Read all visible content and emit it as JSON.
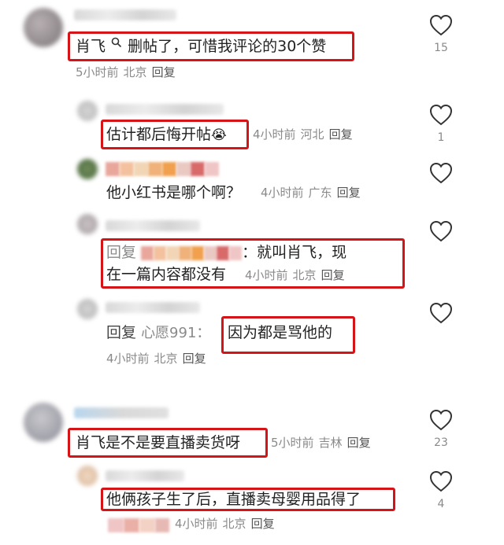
{
  "comments": [
    {
      "text_parts": [
        "肖飞",
        "删帖了，可惜我评论的30个赞"
      ],
      "time": "5小时前",
      "location": "北京",
      "reply_label": "回复",
      "likes": "15"
    },
    {
      "text": "估计都后悔开帖",
      "emoji": "😭",
      "time": "4小时前",
      "location": "河北",
      "reply_label": "回复",
      "likes": "1"
    },
    {
      "text": "他小红书是哪个啊？",
      "time": "4小时前",
      "location": "广东",
      "reply_label": "回复",
      "likes": ""
    },
    {
      "prefix": "回复",
      "line1": "：就叫肖飞，现",
      "line2": "在一篇内容都没有",
      "time": "4小时前",
      "location": "北京",
      "reply_label": "回复",
      "likes": ""
    },
    {
      "prefix": "回复",
      "mention": "心愿991：",
      "text": "因为都是骂他的",
      "time": "4小时前",
      "location": "北京",
      "reply_label": "回复",
      "likes": ""
    },
    {
      "text": "肖飞是不是要直播卖货呀",
      "time": "5小时前",
      "location": "吉林",
      "reply_label": "回复",
      "likes": "23"
    },
    {
      "text": "他俩孩子生了后，直播卖母婴用品得了",
      "time": "4小时前",
      "location": "北京",
      "reply_label": "回复",
      "likes": "4"
    }
  ],
  "icons": {
    "like": "heart-outline-icon",
    "search": "search-icon"
  },
  "colors": {
    "highlight_border": "#d51418",
    "meta_text": "#8a8a8a"
  }
}
